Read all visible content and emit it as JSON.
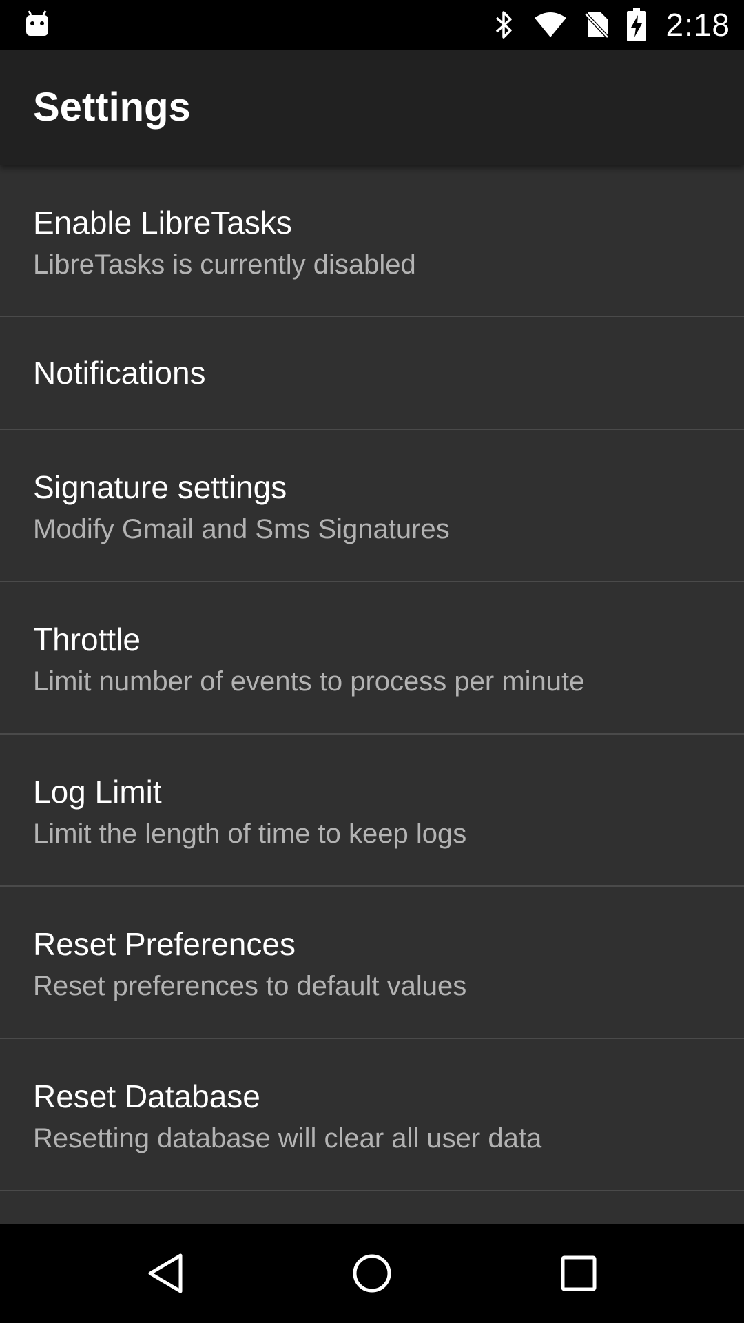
{
  "status_bar": {
    "time": "2:18",
    "icons": [
      "android-notification-icon",
      "bluetooth-icon",
      "wifi-icon",
      "no-sim-icon",
      "battery-charging-icon"
    ]
  },
  "app_bar": {
    "title": "Settings"
  },
  "preferences": [
    {
      "title": "Enable LibreTasks",
      "summary": "LibreTasks is currently disabled"
    },
    {
      "title": "Notifications",
      "summary": ""
    },
    {
      "title": "Signature settings",
      "summary": "Modify Gmail and Sms Signatures"
    },
    {
      "title": "Throttle",
      "summary": "Limit number of events to process per minute"
    },
    {
      "title": "Log Limit",
      "summary": "Limit the length of time to keep logs"
    },
    {
      "title": "Reset Preferences",
      "summary": "Reset preferences to default values"
    },
    {
      "title": "Reset Database",
      "summary": "Resetting database will clear all user data"
    }
  ],
  "nav_bar": {
    "buttons": [
      "back-icon",
      "home-icon",
      "recents-icon"
    ]
  },
  "colors": {
    "background": "#303030",
    "app_bar": "#212121",
    "status_bar": "#000000",
    "title_text": "#ffffff",
    "summary_text": "#b3b3b3",
    "divider": "#4a4a4a"
  }
}
